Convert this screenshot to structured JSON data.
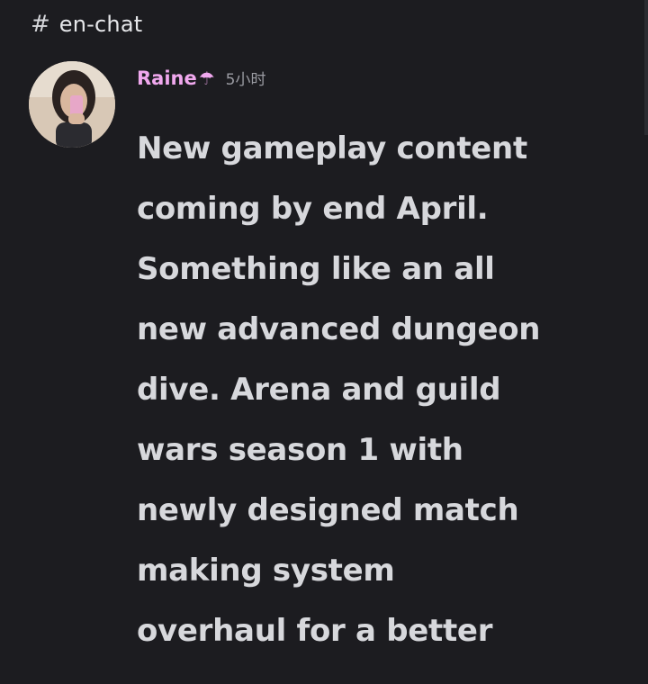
{
  "channel": {
    "icon": "hash-icon",
    "name": "en-chat"
  },
  "message": {
    "author": {
      "name": "Raine",
      "badge_icon": "umbrella-icon",
      "badge_glyph": "☂",
      "name_color": "#f0a8ee"
    },
    "timestamp": "5小时",
    "content": "New gameplay content\ncoming by end April.\nSomething like an all\nnew advanced dungeon\ndive. Arena and guild\nwars season 1 with\nnewly designed match\nmaking system\noverhaul for a better"
  },
  "colors": {
    "background": "#1c1c20",
    "text": "#d7d8dc",
    "muted": "#9a9ba2"
  }
}
